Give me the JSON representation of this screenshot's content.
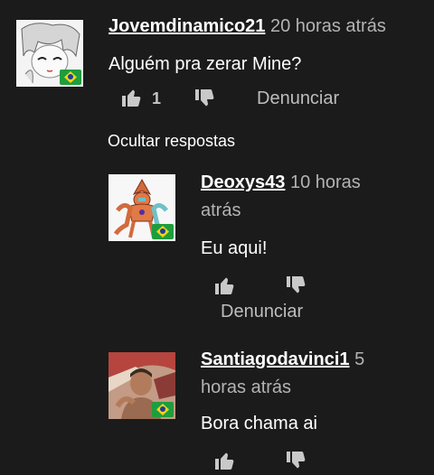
{
  "comments": [
    {
      "author": "Jovemdinamico21",
      "time": "20 horas atrás",
      "text": "Alguém pra zerar Mine?",
      "likes": "1",
      "report": "Denunciar"
    }
  ],
  "hide_replies": "Ocultar respostas",
  "replies": [
    {
      "author": "Deoxys43",
      "time_a": "10 horas",
      "time_b": "atrás",
      "text": "Eu aqui!",
      "report": "Denunciar"
    },
    {
      "author": "Santiagodavinci1",
      "time_a": "5",
      "time_b": "horas atrás",
      "text": "Bora chama ai"
    }
  ],
  "icons": {
    "like": "thumbs-up-icon",
    "dislike": "thumbs-down-icon",
    "flag": "brazil-flag-icon"
  },
  "colors": {
    "background": "#1b1b1b",
    "muted": "#b3b3b3",
    "icon": "#c9c9c9"
  }
}
